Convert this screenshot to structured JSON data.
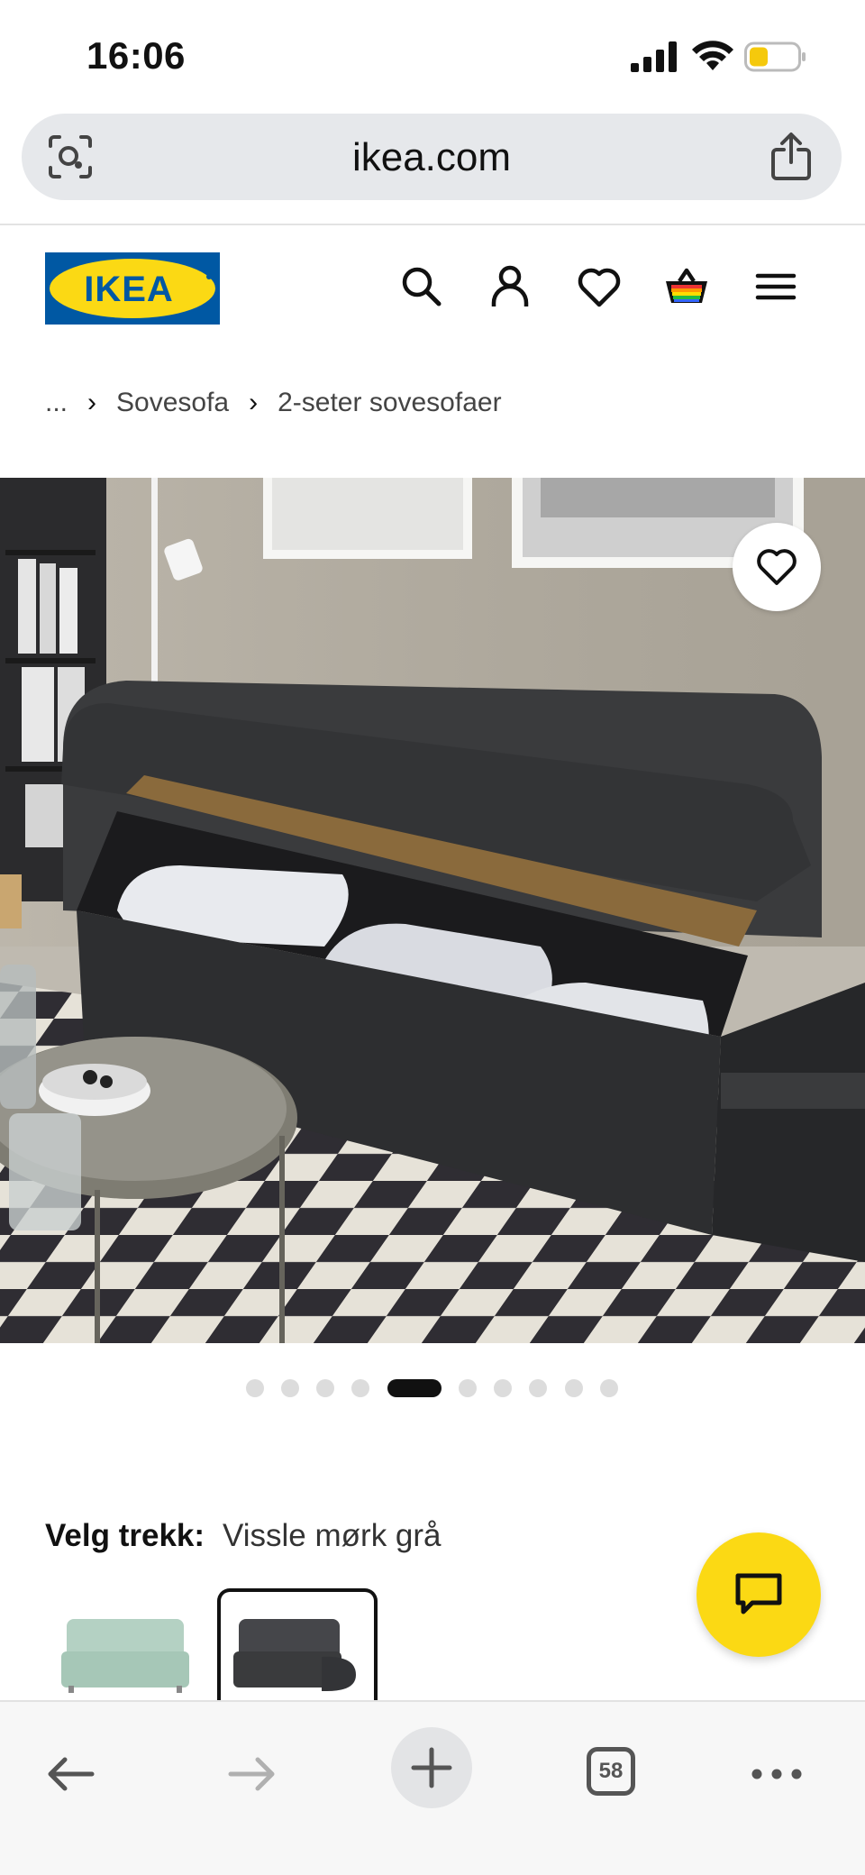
{
  "status_bar": {
    "time": "16:06"
  },
  "browser": {
    "url": "ikea.com",
    "tabs_count": "58"
  },
  "site": {
    "logo_text": "IKEA"
  },
  "breadcrumb": {
    "ellipsis": "...",
    "items": [
      "Sovesofa",
      "2-seter sovesofaer"
    ]
  },
  "gallery": {
    "total_images": 10,
    "active_index": 4
  },
  "cover": {
    "label": "Velg trekk:",
    "value": "Vissle mørk grå"
  },
  "colors": {
    "ikea_blue": "#0058a3",
    "ikea_yellow": "#fbd914",
    "sofa_dark": "#3a3b3d",
    "sofa_green": "#a6c7b7"
  },
  "icons": {
    "header": [
      "search-icon",
      "account-icon",
      "heart-icon",
      "basket-icon",
      "menu-icon"
    ],
    "toolbar": [
      "back-arrow-icon",
      "forward-arrow-icon",
      "plus-icon",
      "tabs-icon",
      "more-icon"
    ]
  }
}
